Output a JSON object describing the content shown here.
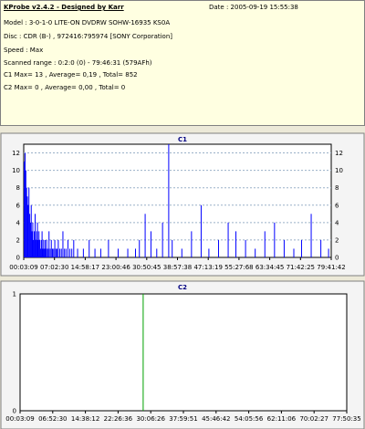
{
  "info": {
    "title": "KProbe v2.4.2 - Designed by Karr",
    "date": "Date : 2005-09-19 15:55:38",
    "model": "Model : 3-0-1-0 LITE-ON DVDRW SOHW-16935 KS0A",
    "disc": "Disc : CDR (B-) , 972416:795974 [SONY Corporation]",
    "speed": "Speed : Max",
    "range": "Scanned range : 0:2:0 (0) - 79:46:31 (579AFh)",
    "c1": "C1 Max= 13 , Average= 0,19 , Total= 852",
    "c2": "C2 Max= 0 , Average= 0,00 , Total= 0"
  },
  "colors": {
    "c1": "#0000ff",
    "c2": "#00a000",
    "grid": "#9ab0c8"
  },
  "chart_data": [
    {
      "type": "bar",
      "title": "C1",
      "ylim": [
        0,
        13
      ],
      "yticks": [
        0,
        2,
        4,
        6,
        8,
        10,
        12
      ],
      "xrange_min": [
        0.05,
        79.69
      ],
      "xtick_labels": [
        "00:03:09",
        "07:02:30",
        "14:58:17",
        "23:00:46",
        "30:50:45",
        "38:57:38",
        "47:13:19",
        "55:27:68",
        "63:34:45",
        "71:42:25",
        "79:41:42"
      ],
      "x_min": [
        0.2,
        0.4,
        0.6,
        0.8,
        1.0,
        1.2,
        1.4,
        1.6,
        1.8,
        2.0,
        2.2,
        2.4,
        2.6,
        2.8,
        3.0,
        3.2,
        3.4,
        3.6,
        3.8,
        4.0,
        4.2,
        4.4,
        4.6,
        4.8,
        5.0,
        5.2,
        5.4,
        5.6,
        5.8,
        6.0,
        6.3,
        6.6,
        6.9,
        7.2,
        7.5,
        7.8,
        8.1,
        8.4,
        8.7,
        9.0,
        9.4,
        9.8,
        10.2,
        10.6,
        11.0,
        11.5,
        12.0,
        12.5,
        13.0,
        14.0,
        15.5,
        17.0,
        18.5,
        20.0,
        22.0,
        24.5,
        27.0,
        29.0,
        30.0,
        31.5,
        33.0,
        34.5,
        36.0,
        37.6,
        38.5,
        41.0,
        43.5,
        46.0,
        48.0,
        50.5,
        53.0,
        55.0,
        57.5,
        60.0,
        62.5,
        65.0,
        67.5,
        70.0,
        72.0,
        74.5,
        77.0,
        79.0
      ],
      "values": [
        11,
        12,
        10,
        8,
        7,
        6,
        8,
        5,
        4,
        6,
        3,
        4,
        2,
        3,
        5,
        2,
        3,
        4,
        2,
        3,
        2,
        1,
        2,
        3,
        1,
        2,
        1,
        2,
        1,
        2,
        1,
        3,
        1,
        2,
        1,
        1,
        2,
        1,
        1,
        2,
        1,
        1,
        3,
        1,
        1,
        2,
        1,
        1,
        2,
        1,
        1,
        2,
        1,
        1,
        2,
        1,
        1,
        1,
        2,
        5,
        3,
        1,
        4,
        13,
        2,
        1,
        3,
        6,
        1,
        2,
        4,
        3,
        2,
        1,
        3,
        4,
        2,
        1,
        2,
        5,
        2,
        1
      ],
      "series": [
        {
          "name": "C1",
          "values": []
        }
      ]
    },
    {
      "type": "line",
      "title": "C2",
      "ylim": [
        0,
        1
      ],
      "yticks": [
        0,
        1
      ],
      "xtick_labels": [
        "00:03:09",
        "06:52:30",
        "14:38:12",
        "22:26:36",
        "30:06:26",
        "37:59:51",
        "45:46:42",
        "54:05:56",
        "62:11:06",
        "70:02:27",
        "77:50:35"
      ],
      "values_total": 0,
      "marker_x_min": 30.06
    }
  ]
}
